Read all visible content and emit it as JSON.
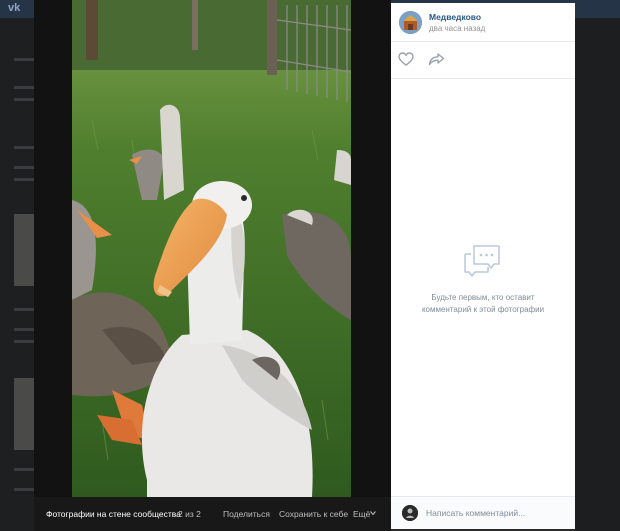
{
  "site": {
    "logo_text": "vk"
  },
  "photo": {
    "description_icon": "goose-photo",
    "album_label": "Фотографии на стене сообщества",
    "counter": "2 из 2",
    "share_label": "Поделиться",
    "save_label": "Сохранить к себе",
    "more_label": "Ещё"
  },
  "panel": {
    "author": "Медведково",
    "time": "два часа назад",
    "like_icon": "heart-icon",
    "repost_icon": "share-arrow-icon",
    "empty_icon": "comments-icon",
    "empty_text_line1": "Будьте первым, кто оставит",
    "empty_text_line2": "комментарий к этой фотографии",
    "comment_placeholder": "Написать комментарий..."
  },
  "colors": {
    "link": "#2a5885",
    "muted": "#818c99",
    "panel_bg": "#ffffff",
    "viewer_bg": "#121212",
    "topbar": "#253447"
  }
}
